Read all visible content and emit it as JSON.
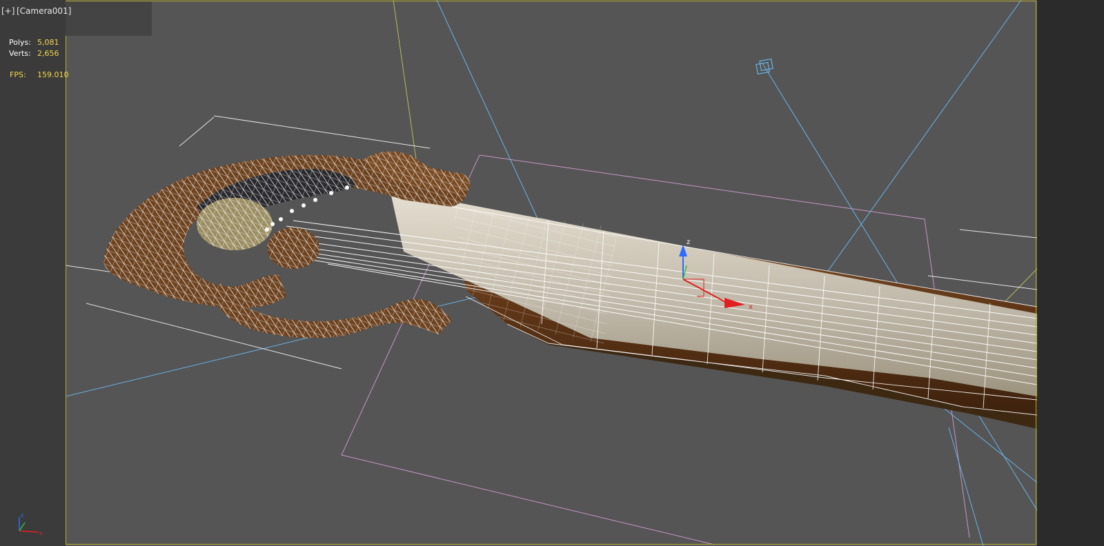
{
  "viewport": {
    "menu_label": "[+]",
    "view_label": "[Camera001]"
  },
  "stats": {
    "polys_label": "Polys:",
    "polys_value": "5,081",
    "verts_label": "Verts:",
    "verts_value": "2,656",
    "fps_label": "FPS:",
    "fps_value": "159.010"
  },
  "gizmo": {
    "z_label": "z",
    "x_label": "x"
  },
  "colors": {
    "viewport_bg": "#555555",
    "active_border": "#b8ad2e",
    "stat_value": "#f3d64a",
    "camera_cone": "#69b4e8",
    "light_helper": "#c896c8",
    "wire": "#ffffff",
    "wood": "#6e4320",
    "fretboard": "#ccc5b6"
  },
  "icons": {
    "axis_tripod": "axis-tripod-icon",
    "transform_gizmo": "move-gizmo-icon",
    "camera_target": "camera-target-icon"
  }
}
